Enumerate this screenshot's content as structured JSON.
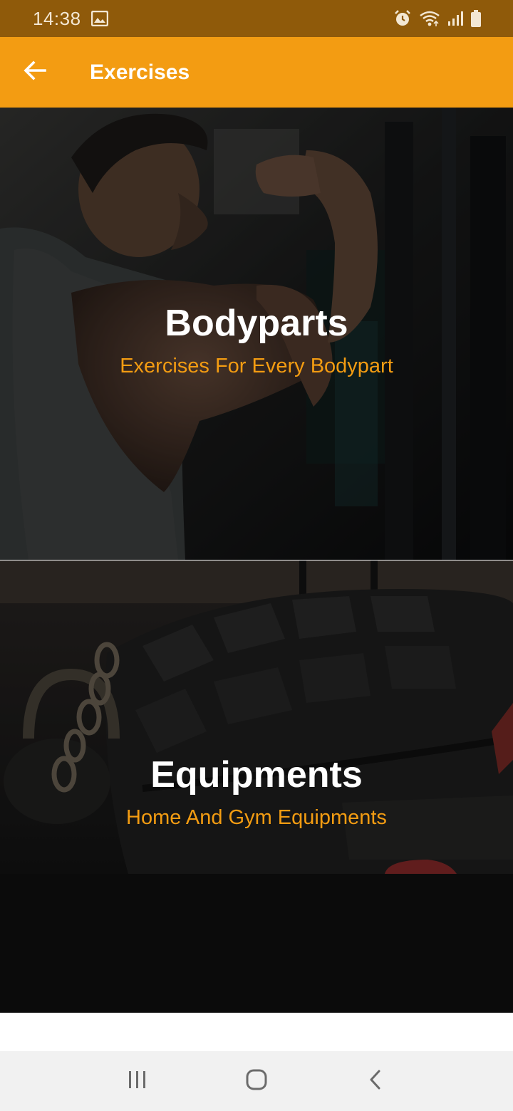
{
  "status_bar": {
    "time": "14:38",
    "left_icons": [
      "image-icon"
    ],
    "right_icons": [
      "alarm-icon",
      "wifi-icon",
      "signal-icon",
      "battery-icon"
    ]
  },
  "app_bar": {
    "back_icon": "arrow-left-icon",
    "title": "Exercises"
  },
  "categories": [
    {
      "title": "Bodyparts",
      "subtitle": "Exercises For Every Bodypart"
    },
    {
      "title": "Equipments",
      "subtitle": "Home And Gym Equipments"
    }
  ],
  "nav_bar": {
    "icons": [
      "recent-apps-icon",
      "home-icon",
      "back-icon"
    ]
  },
  "colors": {
    "status_bar": "#8f5a0a",
    "accent": "#f39c12",
    "title_text": "#ffffff",
    "nav_bar": "#f1f1f1"
  }
}
